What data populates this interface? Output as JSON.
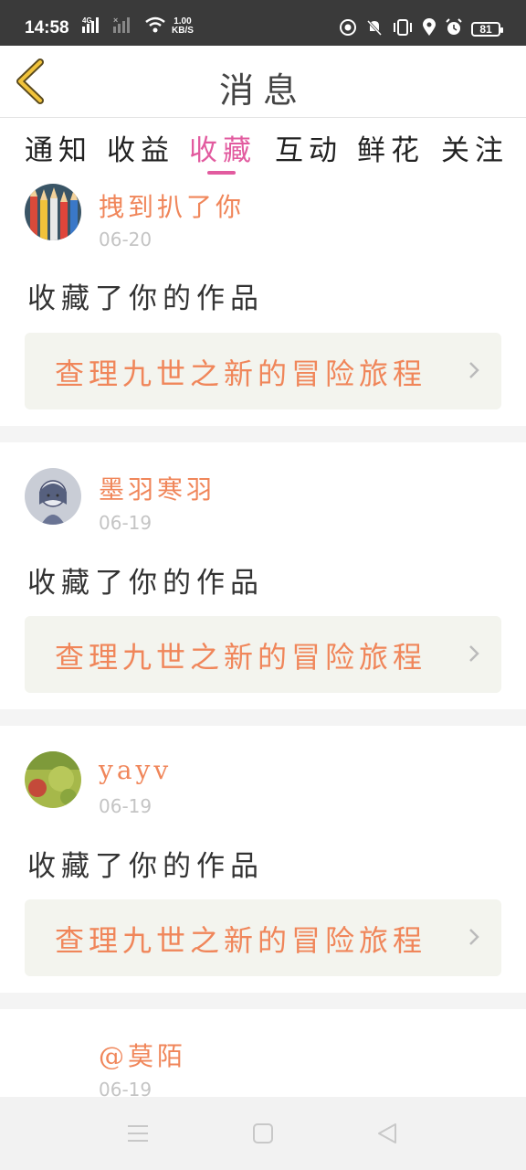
{
  "status": {
    "time": "14:58",
    "network": "4G",
    "speed_value": "1.00",
    "speed_unit": "KB/S",
    "battery": "81"
  },
  "header": {
    "title": "消息",
    "back_icon": "chevron-left-icon"
  },
  "tabs": [
    {
      "label": "通知",
      "active": false
    },
    {
      "label": "收益",
      "active": false
    },
    {
      "label": "收藏",
      "active": true
    },
    {
      "label": "互动",
      "active": false
    },
    {
      "label": "鲜花",
      "active": false
    },
    {
      "label": "关注",
      "active": false
    }
  ],
  "messages": [
    {
      "username": "拽到扒了你",
      "date": "06-20",
      "action": "收藏了你的作品",
      "work_title": "查理九世之新的冒险旅程"
    },
    {
      "username": "墨羽寒羽",
      "date": "06-19",
      "action": "收藏了你的作品",
      "work_title": "查理九世之新的冒险旅程"
    },
    {
      "username": "yayv",
      "date": "06-19",
      "action": "收藏了你的作品",
      "work_title": "查理九世之新的冒险旅程"
    },
    {
      "username": "@莫陌",
      "date": "06-19"
    }
  ],
  "colors": {
    "accent": "#e25b9f",
    "username": "#f0865a",
    "status_bar": "#3a3a3a"
  }
}
